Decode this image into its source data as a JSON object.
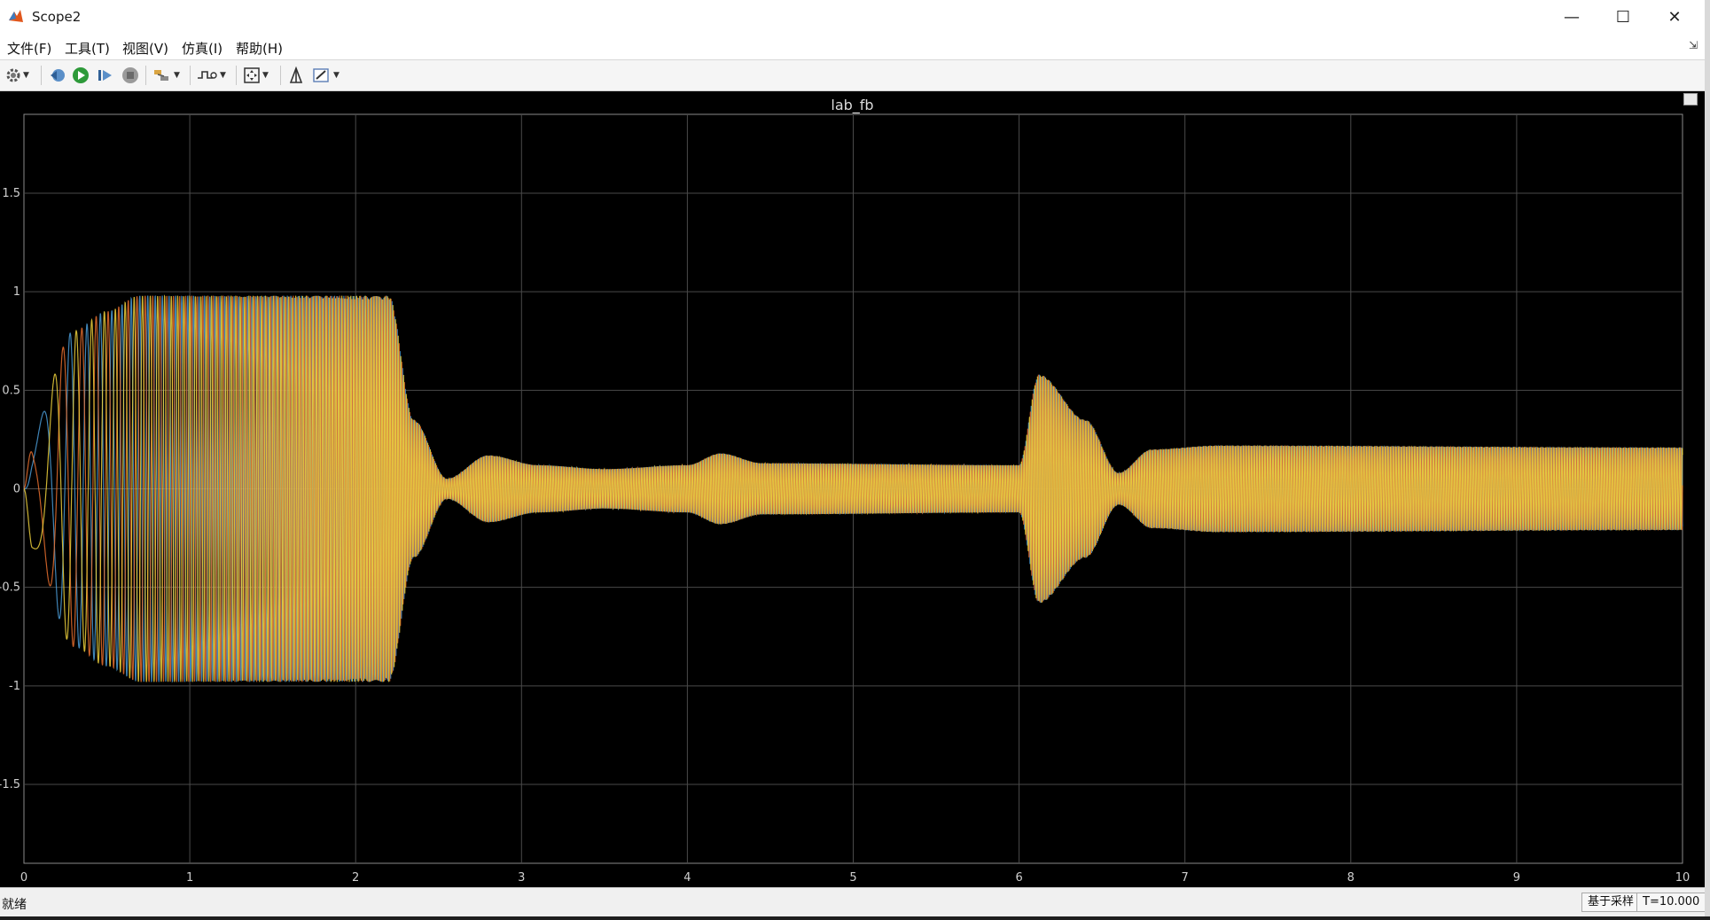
{
  "window": {
    "title": "Scope2",
    "minimize_label": "—",
    "maximize_label": "☐",
    "close_label": "✕"
  },
  "menu": {
    "items": [
      "文件(F)",
      "工具(T)",
      "视图(V)",
      "仿真(I)",
      "帮助(H)"
    ]
  },
  "toolbar": {
    "buttons": [
      {
        "icon": "gear-icon"
      },
      {
        "icon": "step-back-icon"
      },
      {
        "icon": "run-icon"
      },
      {
        "icon": "step-forward-icon"
      },
      {
        "icon": "stop-icon"
      },
      {
        "icon": "highlight-icon"
      },
      {
        "icon": "triggers-icon"
      },
      {
        "icon": "zoom-extents-icon"
      },
      {
        "icon": "lock-axes-icon"
      },
      {
        "icon": "style-icon"
      }
    ]
  },
  "status": {
    "text": "就绪",
    "mode": "基于采样",
    "time": "T=10.000"
  },
  "colors": {
    "background": "#000000",
    "grid": "#4a4a4a",
    "tick_text": "#d0d0d0",
    "series1": "#0072BD",
    "series2": "#D95319",
    "series3": "#EDB120"
  },
  "chart_data": {
    "type": "line",
    "title": "lab_fb",
    "xlabel": "",
    "ylabel": "",
    "xlim": [
      0,
      10
    ],
    "ylim": [
      -1.9,
      1.9
    ],
    "xticks": [
      0,
      1,
      2,
      3,
      4,
      5,
      6,
      7,
      8,
      9,
      10
    ],
    "yticks": [
      -1.5,
      -1,
      -0.5,
      0,
      0.5,
      1,
      1.5
    ],
    "ytick_labels": [
      "-1.5",
      "-1",
      "-0.5",
      "0",
      "0.5",
      "1",
      "1.5"
    ],
    "grid": true,
    "legend": "none",
    "series": [
      {
        "color": "#4a9bd6",
        "phase": 0
      },
      {
        "color": "#e86e2e",
        "phase": 2.094
      },
      {
        "color": "#f0d23c",
        "phase": 4.189
      }
    ],
    "envelope": [
      {
        "t": 0.0,
        "amp": 0.0
      },
      {
        "t": 0.05,
        "amp": 0.3
      },
      {
        "t": 0.3,
        "amp": 0.8
      },
      {
        "t": 0.5,
        "amp": 0.9
      },
      {
        "t": 0.7,
        "amp": 0.98
      },
      {
        "t": 2.2,
        "amp": 0.98
      },
      {
        "t": 2.35,
        "amp": 0.35
      },
      {
        "t": 2.55,
        "amp": 0.05
      },
      {
        "t": 2.8,
        "amp": 0.17
      },
      {
        "t": 3.1,
        "amp": 0.12
      },
      {
        "t": 3.5,
        "amp": 0.1
      },
      {
        "t": 4.0,
        "amp": 0.12
      },
      {
        "t": 4.2,
        "amp": 0.18
      },
      {
        "t": 4.45,
        "amp": 0.13
      },
      {
        "t": 6.0,
        "amp": 0.12
      },
      {
        "t": 6.12,
        "amp": 0.58
      },
      {
        "t": 6.4,
        "amp": 0.35
      },
      {
        "t": 6.6,
        "amp": 0.08
      },
      {
        "t": 6.8,
        "amp": 0.2
      },
      {
        "t": 7.2,
        "amp": 0.22
      },
      {
        "t": 10.0,
        "amp": 0.21
      }
    ]
  }
}
